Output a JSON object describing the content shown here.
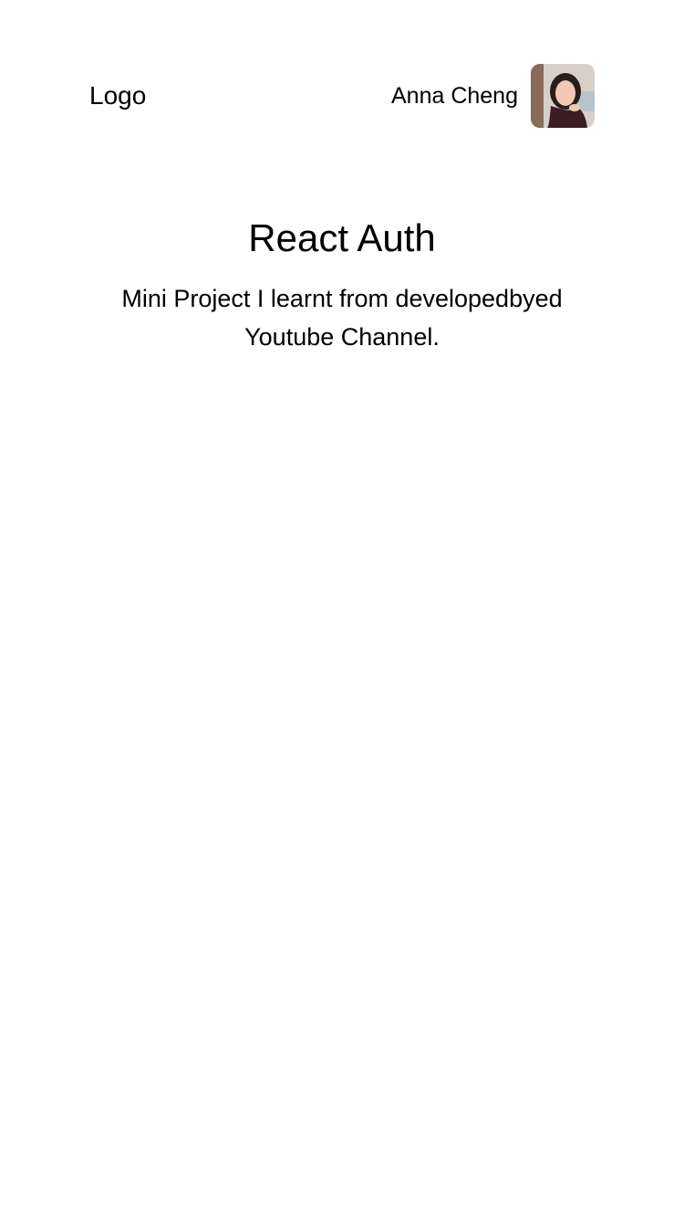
{
  "header": {
    "logo_text": "Logo",
    "user": {
      "name": "Anna Cheng",
      "avatar_icon": "user-avatar-photo"
    }
  },
  "hero": {
    "title": "React Auth",
    "subtitle": "Mini Project I learnt from developedbyed Youtube Channel."
  },
  "colors": {
    "background": "#ffffff",
    "text": "#000000"
  }
}
